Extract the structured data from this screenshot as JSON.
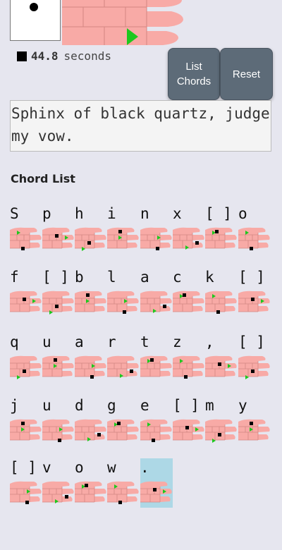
{
  "timer": {
    "value": "44.8",
    "unit": "seconds"
  },
  "buttons": {
    "list_label": "List Chords",
    "reset_label": "Reset"
  },
  "text_input": {
    "value": "Sphinx of black quartz, judge my vow."
  },
  "chord_list": {
    "heading": "Chord List",
    "highlighted_char": ".",
    "rows": [
      [
        {
          "char": "S"
        },
        {
          "char": "p"
        },
        {
          "char": "h"
        },
        {
          "char": "i"
        },
        {
          "char": "n"
        },
        {
          "char": "x"
        },
        {
          "char": "[ ]"
        },
        {
          "char": "o"
        }
      ],
      [
        {
          "char": "f"
        },
        {
          "char": "[ ]"
        },
        {
          "char": "b"
        },
        {
          "char": "l"
        },
        {
          "char": "a"
        },
        {
          "char": "c"
        },
        {
          "char": "k"
        },
        {
          "char": "[ ]"
        }
      ],
      [
        {
          "char": "q"
        },
        {
          "char": "u"
        },
        {
          "char": "a"
        },
        {
          "char": "r"
        },
        {
          "char": "t"
        },
        {
          "char": "z"
        },
        {
          "char": ","
        },
        {
          "char": "[ ]"
        }
      ],
      [
        {
          "char": "j"
        },
        {
          "char": "u"
        },
        {
          "char": "d"
        },
        {
          "char": "g"
        },
        {
          "char": "e"
        },
        {
          "char": "[ ]"
        },
        {
          "char": "m"
        },
        {
          "char": "y"
        }
      ],
      [
        {
          "char": "[ ]"
        },
        {
          "char": "v"
        },
        {
          "char": "o"
        },
        {
          "char": "w"
        },
        {
          "char": "."
        }
      ]
    ]
  },
  "colors": {
    "skin": "#f8aaa6",
    "skin_line": "#d38783",
    "marker_green": "#1ec81e",
    "marker_black": "#000000",
    "button_bg": "#5d6b78",
    "highlight": "#add8e6"
  }
}
